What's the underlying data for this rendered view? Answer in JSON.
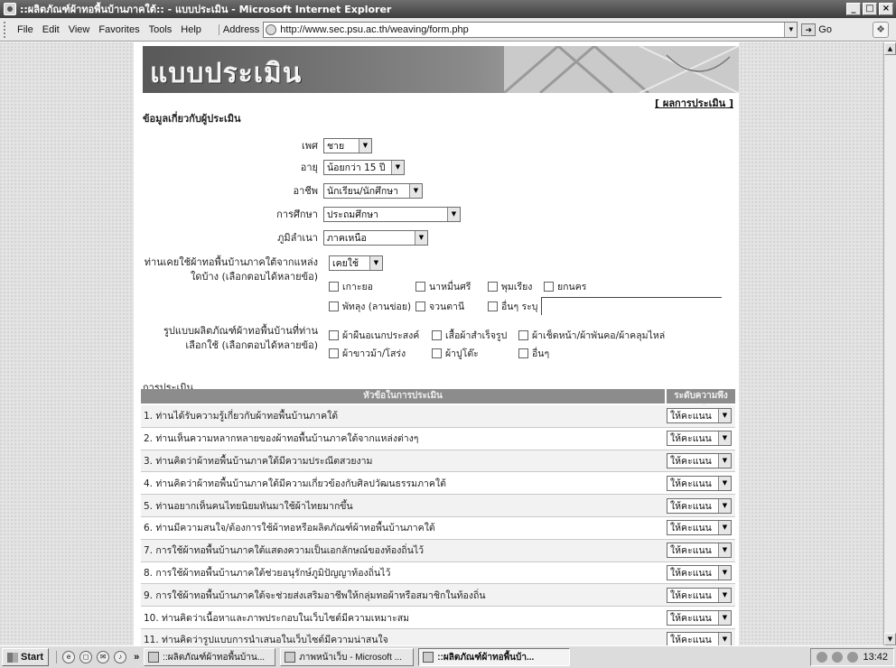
{
  "window": {
    "title": "::ผลิตภัณฑ์ผ้าทอพื้นบ้านภาคใต้:: - แบบประเมิน - Microsoft Internet Explorer",
    "minimize": "_",
    "maximize": "□",
    "close": "×"
  },
  "menu": {
    "items": [
      "File",
      "Edit",
      "View",
      "Favorites",
      "Tools",
      "Help"
    ],
    "address_label": "Address",
    "url": "http://www.sec.psu.ac.th/weaving/form.php",
    "go_label": "Go"
  },
  "page": {
    "banner_title": "แบบประเมิน",
    "results_link": "ผลการประเมิน",
    "evaluator_heading": "ข้อมูลเกี่ยวกับผู้ประเมิน",
    "fields": {
      "gender": {
        "label": "เพศ",
        "value": "ชาย"
      },
      "age": {
        "label": "อายุ",
        "value": "น้อยกว่า 15 ปี"
      },
      "occupation": {
        "label": "อาชีพ",
        "value": "นักเรียน/นักศึกษา"
      },
      "education": {
        "label": "การศึกษา",
        "value": "ประถมศึกษา"
      },
      "region": {
        "label": "ภูมิลำเนา",
        "value": "ภาคเหนือ"
      },
      "used_before": {
        "label": "ท่านเคยใช้ผ้าทอพื้นบ้านภาคใต้จากแหล่งใดบ้าง (เลือกตอบได้หลายข้อ)",
        "value": "เคยใช้"
      }
    },
    "sources": {
      "row1": [
        "เกาะยอ",
        "นาหมื่นศรี",
        "พุมเรียง",
        "ยกนคร"
      ],
      "row2": [
        "พัทลุง (ลานข่อย)",
        "จวนตานี",
        "อื่นๆ ระบุ"
      ]
    },
    "product_label": "รูปแบบผลิตภัณฑ์ผ้าทอพื้นบ้านที่ท่านเลือกใช้ (เลือกตอบได้หลายข้อ)",
    "products": {
      "row1": [
        "ผ้าผืนอเนกประสงค์",
        "เสื้อผ้าสำเร็จรูป",
        "ผ้าเช็ดหน้า/ผ้าพันคอ/ผ้าคลุมไหล่"
      ],
      "row2": [
        "ผ้าขาวม้า/โสร่ง",
        "ผ้าปูโต๊ะ",
        "อื่นๆ"
      ]
    },
    "evaluation_heading": "การประเมิน",
    "eval_header_question": "หัวข้อในการประเมิน",
    "eval_header_level": "ระดับความพึงพอใจ",
    "eval_default": "ให้คะแนน",
    "questions": [
      "1. ท่านได้รับความรู้เกี่ยวกับผ้าทอพื้นบ้านภาคใต้",
      "2. ท่านเห็นความหลากหลายของผ้าทอพื้นบ้านภาคใต้จากแหล่งต่างๆ",
      "3. ท่านคิดว่าผ้าทอพื้นบ้านภาคใต้มีความประณีตสวยงาม",
      "4. ท่านคิดว่าผ้าทอพื้นบ้านภาคใต้มีความเกี่ยวข้องกับศิลปวัฒนธรรมภาคใต้",
      "5. ท่านอยากเห็นคนไทยนิยมหันมาใช้ผ้าไทยมากขึ้น",
      "6. ท่านมีความสนใจ/ต้องการใช้ผ้าทอหรือผลิตภัณฑ์ผ้าทอพื้นบ้านภาคใต้",
      "7. การใช้ผ้าทอพื้นบ้านภาคใต้แสดงความเป็นเอกลักษณ์ของท้องถิ่นไว้",
      "8. การใช้ผ้าทอพื้นบ้านภาคใต้ช่วยอนุรักษ์ภูมิปัญญาท้องถิ่นไว้",
      "9. การใช้ผ้าทอพื้นบ้านภาคใต้จะช่วยส่งเสริมอาชีพให้กลุ่มทอผ้าหรือสมาชิกในท้องถิ่น",
      "10. ท่านคิดว่าเนื้อหาและภาพประกอบในเว็บไซต์มีความเหมาะสม",
      "11. ท่านคิดว่ารูปแบบการนำเสนอในเว็บไซต์มีความน่าสนใจ"
    ]
  },
  "taskbar": {
    "start": "Start",
    "chevron": "»",
    "tasks": [
      "::ผลิตภัณฑ์ผ้าทอพื้นบ้าน...",
      "ภาพหน้าเว็บ - Microsoft ...",
      "::ผลิตภัณฑ์ผ้าทอพื้นบ้า..."
    ],
    "clock": "13:42"
  }
}
